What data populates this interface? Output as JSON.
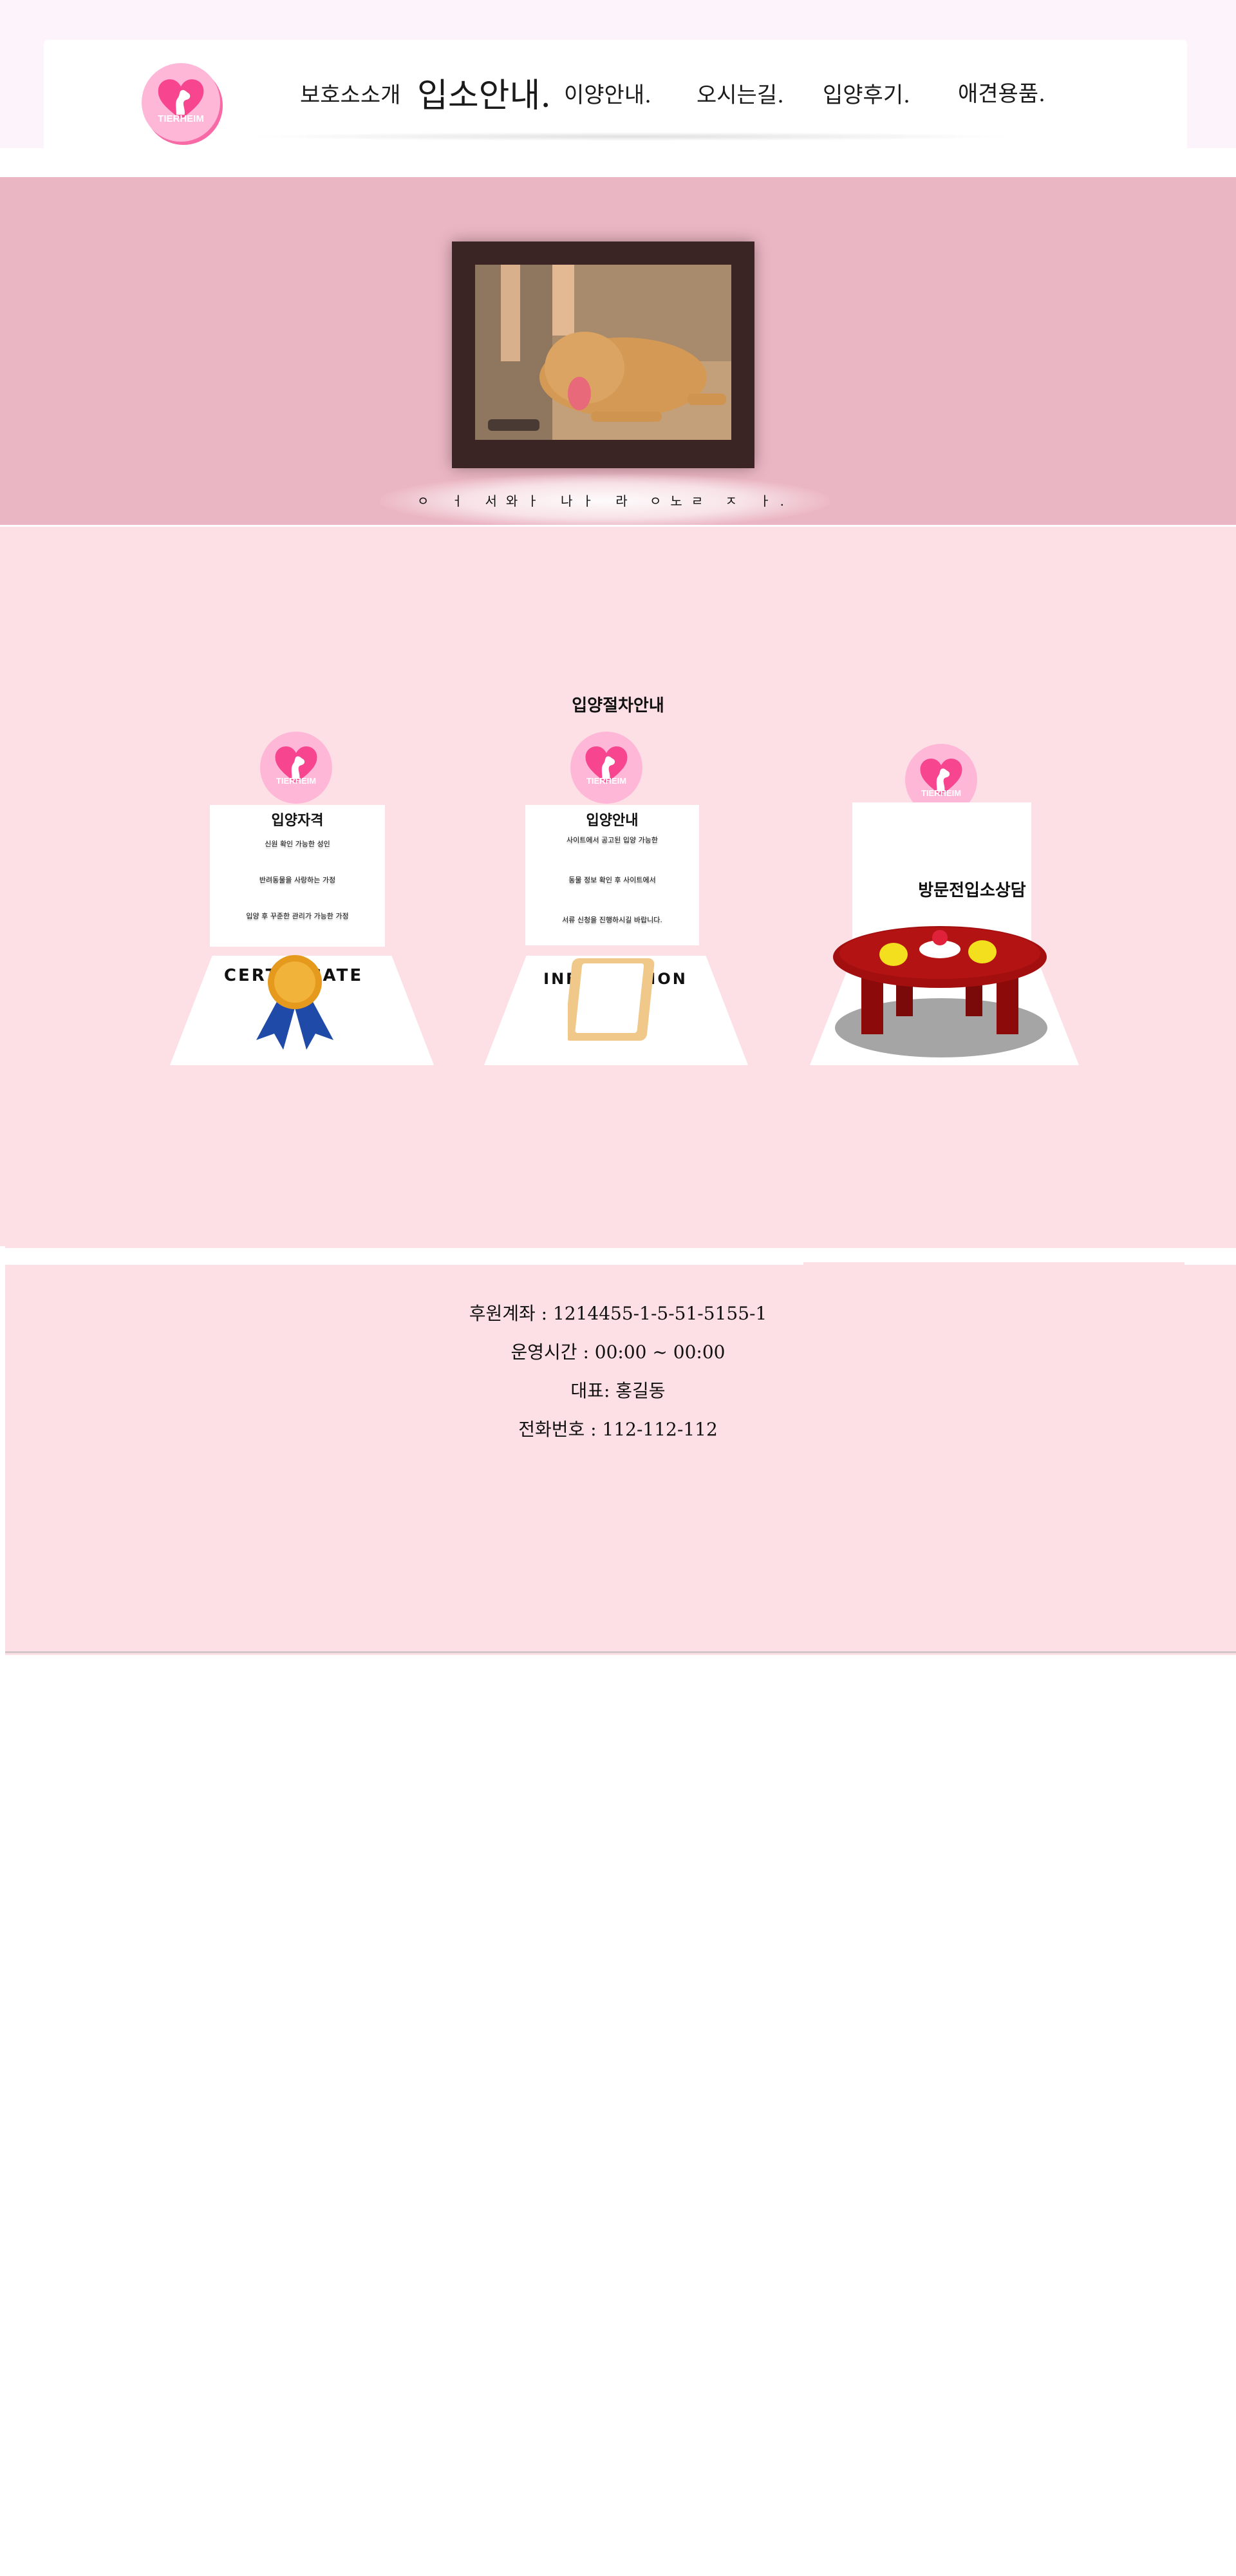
{
  "header": {
    "brand": "TIERHEIM",
    "nav": [
      {
        "label": "보호소소개"
      },
      {
        "label": "입소안내."
      },
      {
        "label": "이양안내."
      },
      {
        "label": "오시는길."
      },
      {
        "label": "입양후기."
      },
      {
        "label": "애견용품."
      }
    ]
  },
  "hero": {
    "caption": "ㅇ ㅓ 서와ㅏ 나ㅏ 라 ㅇ노ㄹ ㅈ ㅏ."
  },
  "steps": {
    "title": "입양절차안내",
    "cards": [
      {
        "brand": "TIERHEIM",
        "title": "입양자격",
        "lines": [
          "신원 확인 가능한 성인",
          "반려동물을 사랑하는 가정",
          "입양 후 꾸준한 관리가 가능한 가정"
        ],
        "base_label": "CERTIFICATE",
        "icon": "medal-icon"
      },
      {
        "brand": "TIERHEIM",
        "title": "입양안내",
        "lines": [
          "사이트에서 공고된 입양 가능한",
          "동물 정보 확인 후 사이트에서",
          "서류 신청을 진행하시길 바랍니다."
        ],
        "base_label": "INFORMATION",
        "icon": "clipboard-icon"
      },
      {
        "brand": "TIERHEIM",
        "title": "방문전입소상담",
        "icon": "table-icon"
      }
    ]
  },
  "footer": {
    "account": "후원계좌 : 1214455-1-5-51-5155-1",
    "hours": "운영시간 : 00:00 ~ 00:00",
    "representative": "대표: 홍길동",
    "phone": "전화번호 : 112-112-112"
  },
  "colors": {
    "hero_bg": "#ebb6c3",
    "section_bg": "#fde0e6",
    "logo_pink": "#ffb7d8",
    "logo_accent": "#f76aa6",
    "table_red": "#a30f0f"
  }
}
